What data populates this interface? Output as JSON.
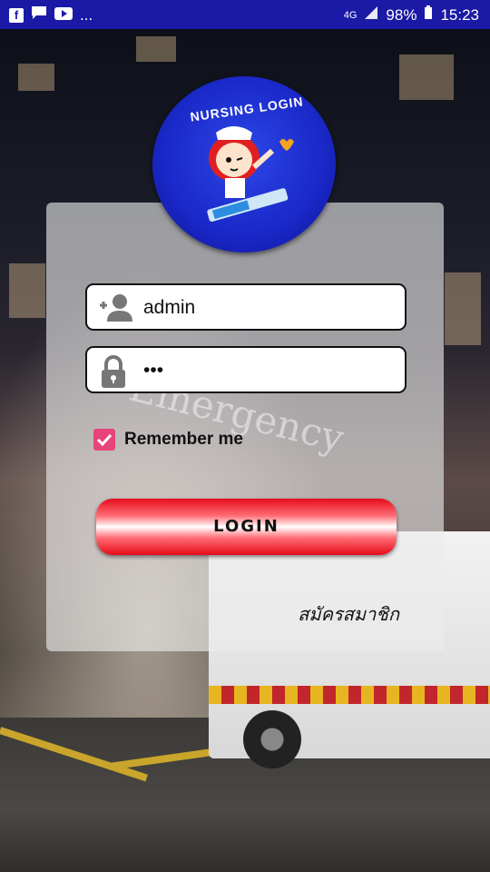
{
  "status_bar": {
    "network": "4G",
    "battery": "98%",
    "time": "15:23",
    "notification_icons": [
      "facebook-icon",
      "message-icon",
      "youtube-icon"
    ],
    "more": "..."
  },
  "logo": {
    "text": "NURSING LOGIN"
  },
  "username": {
    "value": "admin",
    "icon": "add-person-icon"
  },
  "password": {
    "value": "•••",
    "icon": "lock-icon"
  },
  "remember": {
    "label": "Remember me",
    "checked": true
  },
  "login_button": {
    "label": "LOGIN"
  },
  "register_link": {
    "label": "สมัครสมาชิก"
  },
  "colors": {
    "status_bar": "#1a1aa6",
    "checkbox": "#e6447a",
    "button_red": "#e60b1a",
    "logo_blue": "#1a28c8"
  }
}
